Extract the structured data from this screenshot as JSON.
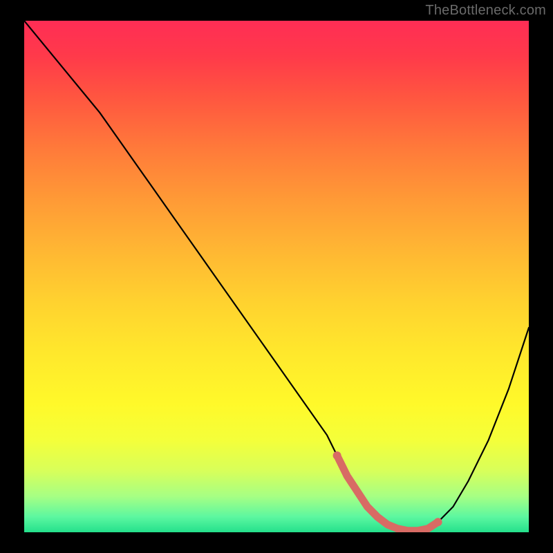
{
  "watermark": "TheBottleneck.com",
  "colors": {
    "frame_bg": "#000000",
    "watermark": "#6a6a6a",
    "curve": "#000000",
    "marker": "#d86b64",
    "gradient_top": "#ff2d55",
    "gradient_bottom": "#24e08c"
  },
  "chart_data": {
    "type": "line",
    "title": "",
    "xlabel": "",
    "ylabel": "",
    "xlim": [
      0,
      100
    ],
    "ylim": [
      0,
      100
    ],
    "grid": false,
    "legend": false,
    "series": [
      {
        "name": "bottleneck-curve",
        "x": [
          0,
          5,
          10,
          15,
          20,
          25,
          30,
          35,
          40,
          45,
          50,
          55,
          60,
          62,
          64,
          66,
          68,
          70,
          72,
          74,
          76,
          78,
          80,
          82,
          85,
          88,
          92,
          96,
          100
        ],
        "y": [
          100,
          94,
          88,
          82,
          75,
          68,
          61,
          54,
          47,
          40,
          33,
          26,
          19,
          15,
          11,
          8,
          5,
          3,
          1.5,
          0.7,
          0.3,
          0.3,
          0.7,
          2,
          5,
          10,
          18,
          28,
          40
        ]
      }
    ],
    "markers": [
      {
        "name": "optimal-range",
        "x": [
          62,
          64,
          66,
          68,
          70,
          72,
          74,
          76,
          78,
          80,
          82
        ],
        "y": [
          15,
          11,
          8,
          5,
          3,
          1.5,
          0.7,
          0.3,
          0.3,
          0.7,
          2
        ]
      }
    ],
    "annotations": []
  }
}
